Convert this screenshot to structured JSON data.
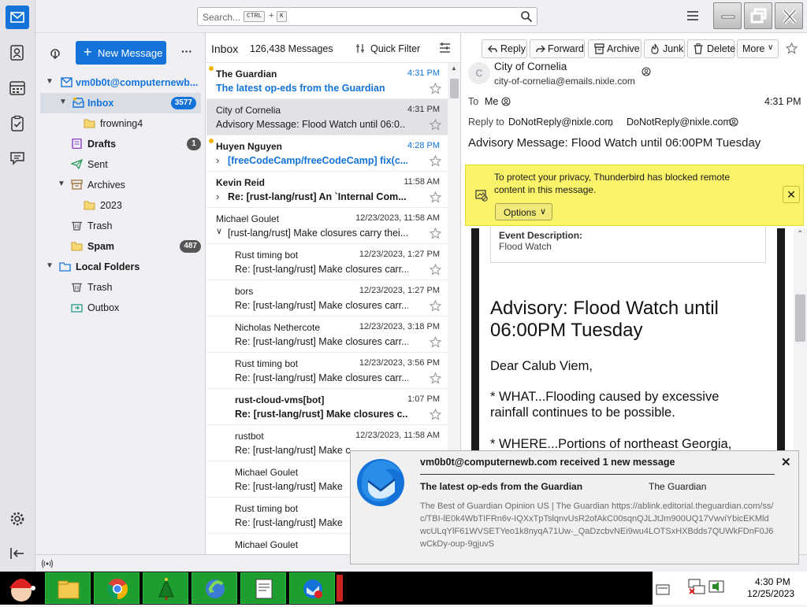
{
  "search": {
    "placeholder": "Search...",
    "key1": "CTRL",
    "plus": "+",
    "key2": "K"
  },
  "folder_pane": {
    "new_message": "New Message",
    "account": "vm0b0t@computernewb...",
    "folders": [
      {
        "name": "Inbox",
        "count": "3577"
      },
      {
        "name": "frowning4"
      },
      {
        "name": "Drafts",
        "count": "1"
      },
      {
        "name": "Sent"
      },
      {
        "name": "Archives"
      },
      {
        "name": "2023"
      },
      {
        "name": "Trash"
      },
      {
        "name": "Spam",
        "count": "487"
      },
      {
        "name": "Local Folders"
      },
      {
        "name": "Trash"
      },
      {
        "name": "Outbox"
      }
    ]
  },
  "list": {
    "title": "Inbox",
    "count": "126,438 Messages",
    "quick_filter": "Quick Filter",
    "messages": [
      {
        "from": "The Guardian",
        "date": "4:31 PM",
        "subject": "The latest op-eds from the Guardian"
      },
      {
        "from": "City of Cornelia",
        "date": "4:31 PM",
        "subject": "Advisory Message: Flood Watch until 06:0..."
      },
      {
        "from": "Huyen Nguyen",
        "date": "4:28 PM",
        "subject": "[freeCodeCamp/freeCodeCamp] fix(c..."
      },
      {
        "from": "Kevin Reid",
        "date": "11:58 AM",
        "subject": "Re: [rust-lang/rust] An `Internal Com..."
      },
      {
        "from": "Michael Goulet",
        "date": "12/23/2023, 11:58 AM",
        "subject": "[rust-lang/rust] Make closures carry thei..."
      },
      {
        "from": "Rust timing bot",
        "date": "12/23/2023, 1:27 PM",
        "subject": "Re: [rust-lang/rust] Make closures carr..."
      },
      {
        "from": "bors",
        "date": "12/23/2023, 1:27 PM",
        "subject": "Re: [rust-lang/rust] Make closures carr..."
      },
      {
        "from": "Nicholas Nethercote",
        "date": "12/23/2023, 3:18 PM",
        "subject": "Re: [rust-lang/rust] Make closures carr..."
      },
      {
        "from": "Rust timing bot",
        "date": "12/23/2023, 3:56 PM",
        "subject": "Re: [rust-lang/rust] Make closures carr..."
      },
      {
        "from": "rust-cloud-vms[bot]",
        "date": "1:07 PM",
        "subject": "Re: [rust-lang/rust] Make closures c..."
      },
      {
        "from": "rustbot",
        "date": "12/23/2023, 11:58 AM",
        "subject": "Re: [rust-lang/rust] Make c"
      },
      {
        "from": "Michael Goulet",
        "date": "",
        "subject": "Re: [rust-lang/rust] Make"
      },
      {
        "from": "Rust timing bot",
        "date": "",
        "subject": "Re: [rust-lang/rust] Make"
      },
      {
        "from": "Michael Goulet",
        "date": "",
        "subject": ""
      }
    ]
  },
  "toolbar": {
    "reply": "Reply",
    "forward": "Forward",
    "archive": "Archive",
    "junk": "Junk",
    "delete": "Delete",
    "more": "More"
  },
  "header": {
    "avatar": "C",
    "from_name": "City of Cornelia",
    "from_email": "city-of-cornelia@emails.nixle.com",
    "to_label": "To",
    "to_value": "Me",
    "time": "4:31 PM",
    "reply_label": "Reply to",
    "reply_1": "DoNotReply@nixle.com",
    "reply_2": "DoNotReply@nixle.com",
    "subject": "Advisory Message: Flood Watch until 06:00PM Tuesday"
  },
  "notice": {
    "text": "To protect your privacy, Thunderbird has blocked remote content in this message.",
    "options": "Options"
  },
  "body": {
    "event_label": "Event Description:",
    "event_value": "Flood Watch",
    "heading": "Advisory: Flood Watch until 06:00PM Tuesday",
    "greeting": "Dear Calub Viem,",
    "what": "* WHAT...Flooding caused by excessive rainfall continues to be possible.",
    "where": "* WHERE...Portions of northeast Georgia,"
  },
  "notification": {
    "title": "vm0b0t@computernewb.com received 1 new message",
    "subject": "The latest op-eds from the Guardian",
    "sender": "The Guardian",
    "body": "The Best of Guardian Opinion US | The Guardian https://ablink.editorial.theguardian.com/ss/c/TBI-lE0k4WbTIFRn6v-IQXxTpTslqnvUsR2ofAkC00sqnQJLJtJm900UQ17VwviYbicEKMldwcULqYlF61WVSETYeo1k8nyqA71Uw-_QaDzcbvNEi9wu4LOTSxHXBdds7QUWkFDnF0J6wCkDy-oup-9gjuvS"
  },
  "clock": {
    "time": "4:30 PM",
    "date": "12/25/2023"
  },
  "colors": {
    "accent": "#1373d9",
    "notice": "#fbf36a",
    "taskbar_app": "#1e9e2e",
    "unread_dot": "#f0b400"
  }
}
